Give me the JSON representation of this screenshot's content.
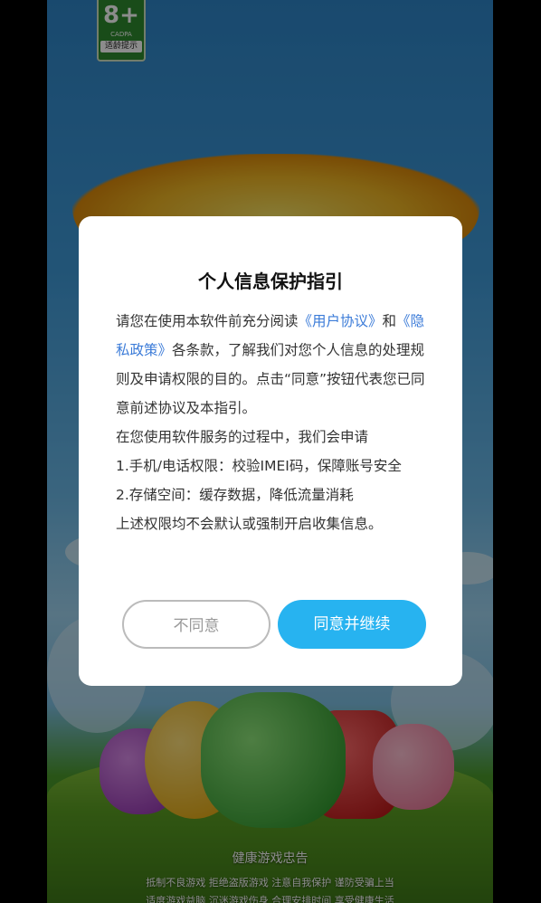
{
  "age_badge": {
    "rating": "8+",
    "org": "CADPA",
    "tip": "适龄提示"
  },
  "dialog": {
    "title": "个人信息保护指引",
    "intro_prefix": "请您在使用本软件前充分阅读",
    "user_agreement_link": "《用户协议》",
    "and_text": "和",
    "privacy_policy_link": "《隐私政策》",
    "intro_suffix": "各条款，了解我们对您个人信息的处理规则及申请权限的目的。点击“同意”按钮代表您已同意前述协议及本指引。",
    "permissions_intro": "在您使用软件服务的过程中，我们会申请",
    "permission_1": "1.手机/电话权限：校验IMEI码，保障账号安全",
    "permission_2": "2.存储空间：缓存数据，降低流量消耗",
    "closing": "上述权限均不会默认或强制开启收集信息。",
    "decline_label": "不同意",
    "agree_label": "同意并继续"
  },
  "footer": {
    "title": "健康游戏忠告",
    "line1": "抵制不良游戏  拒绝盗版游戏  注意自我保护  谨防受骗上当",
    "line2": "适度游戏益脑  沉迷游戏伤身  合理安排时间  享受健康生活"
  },
  "colors": {
    "accent": "#27b3f0",
    "link": "#3b7bd8"
  }
}
